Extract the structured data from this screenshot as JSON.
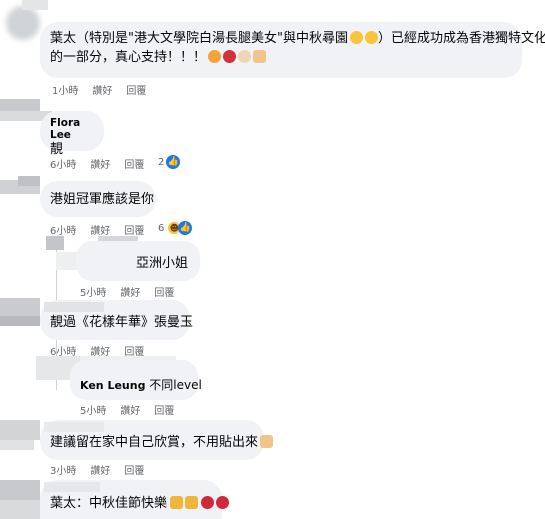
{
  "comments": [
    {
      "text_line1": "葉太（特別是\"港大文學院白湯長腿美女\"與中秋尋園",
      "text_line1_tail": "）已經成功成為香港獨特文化",
      "text_line2": "的一部分，真心支持！！！",
      "time": "1小時",
      "like": "讚好",
      "reply": "回覆"
    },
    {
      "author": "Flora Lee",
      "text": "靚",
      "time": "6小時",
      "like": "讚好",
      "reply": "回覆",
      "reactions": "2"
    },
    {
      "text": "港姐冠軍應該是你",
      "time": "6小時",
      "like": "讚好",
      "reply": "回覆",
      "reactions": "6"
    },
    {
      "text": "亞洲小姐",
      "time": "5小時",
      "like": "讚好",
      "reply": "回覆"
    },
    {
      "text": "靚過《花樣年華》張曼玉",
      "time": "6小時",
      "like": "讚好",
      "reply": "回覆"
    },
    {
      "author": "Ken Leung",
      "text": "不同level",
      "time": "5小時",
      "like": "讚好",
      "reply": "回覆"
    },
    {
      "text": "建議留在家中自己欣賞，不用貼出來",
      "time": "3小時",
      "like": "讚好",
      "reply": "回覆"
    },
    {
      "text": "葉太：中秋佳節快樂"
    }
  ],
  "icons": {
    "like": "like-reaction-icon",
    "haha": "haha-reaction-icon"
  },
  "colors": {
    "bubble": "#f0f2f5",
    "meta_text": "#65676b",
    "like_blue": "#1877f2"
  }
}
